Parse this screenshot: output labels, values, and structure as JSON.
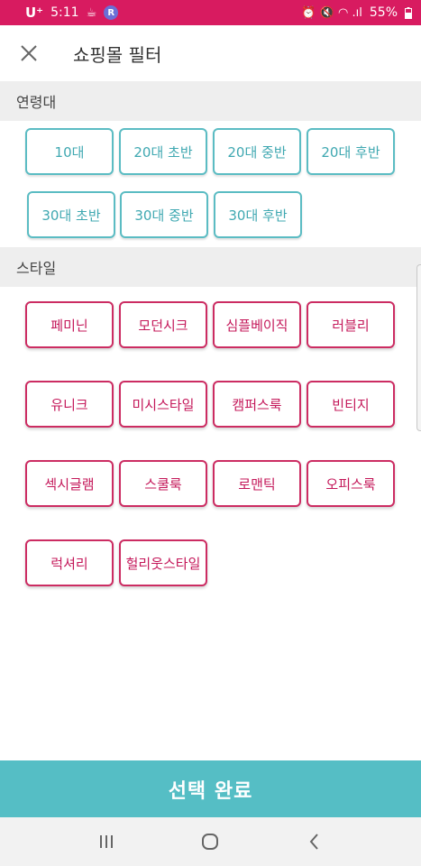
{
  "status_bar": {
    "carrier": "U⁺",
    "time": "5:11",
    "cup_icon": "☕",
    "badge": "R",
    "right_icons": "⏰ 🔇 ◠ .ıl",
    "battery": "55%"
  },
  "header": {
    "title": "쇼핑몰 필터"
  },
  "age_section": {
    "title": "연령대",
    "items": [
      "10대",
      "20대 초반",
      "20대 중반",
      "20대 후반",
      "30대 초반",
      "30대 중반",
      "30대 후반"
    ]
  },
  "style_section": {
    "title": "스타일",
    "items": [
      "페미닌",
      "모던시크",
      "심플베이직",
      "러블리",
      "유니크",
      "미시스타일",
      "캠퍼스룩",
      "빈티지",
      "섹시글램",
      "스쿨룩",
      "로맨틱",
      "오피스룩",
      "럭셔리",
      "헐리웃스타일"
    ]
  },
  "complete_button": {
    "label": "선택 완료"
  },
  "colors": {
    "status_bar": "#d81b60",
    "age_chip_border": "#5bbcc3",
    "style_chip_border": "#cc2c62",
    "complete_button": "#55bec5"
  }
}
